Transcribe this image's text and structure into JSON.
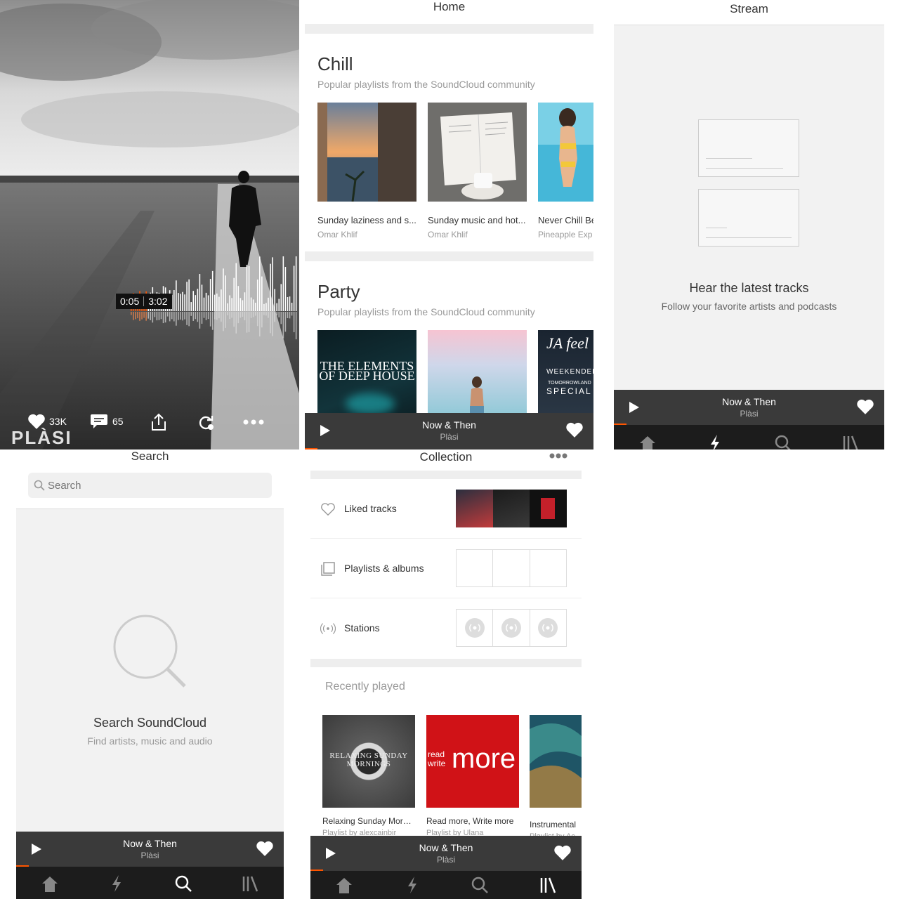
{
  "player_screen": {
    "time_current": "0:05",
    "time_total": "3:02",
    "likes": "33K",
    "comments": "65",
    "watermark": "PLÀSI",
    "icons": [
      "heart-icon",
      "comment-icon",
      "share-icon",
      "repost-icon",
      "more-icon"
    ]
  },
  "home": {
    "title": "Home",
    "sections": [
      {
        "title": "Chill",
        "subtitle": "Popular playlists from the SoundCloud community",
        "items": [
          {
            "title": "Sunday laziness and s...",
            "author": "Omar Khlif"
          },
          {
            "title": "Sunday music and hot...",
            "author": "Omar Khlif"
          },
          {
            "title": "Never Chill Be",
            "author": "Pineapple Exp"
          }
        ]
      },
      {
        "title": "Party",
        "subtitle": "Popular playlists from the SoundCloud community",
        "items": [
          {
            "title": "THE ELEMENTS OF DEEP HOUSE",
            "author": ""
          },
          {
            "title": "",
            "author": ""
          },
          {
            "title": "JA feel WEEKENDER TOMORROWLAND SPECIAL",
            "author": ""
          }
        ]
      }
    ]
  },
  "stream": {
    "title": "Stream",
    "empty_title": "Hear the latest tracks",
    "empty_subtitle": "Follow your favorite artists and podcasts"
  },
  "search": {
    "title": "Search",
    "placeholder": "Search",
    "empty_title": "Search SoundCloud",
    "empty_subtitle": "Find artists, music and audio"
  },
  "collection": {
    "title": "Collection",
    "rows": [
      {
        "label": "Liked tracks",
        "icon": "heart-outline-icon"
      },
      {
        "label": "Playlists & albums",
        "icon": "playlist-icon"
      },
      {
        "label": "Stations",
        "icon": "station-icon"
      }
    ],
    "recent_title": "Recently played",
    "recent": [
      {
        "title": "Relaxing Sunday Morni...",
        "subtitle": "Playlist by alexcainbir",
        "art_text": "RELAXING SUNDAY MORNINGS"
      },
      {
        "title": "Read more, Write more",
        "subtitle": "Playlist by Ulana",
        "art_text_small": "read write",
        "art_text_big": "more"
      },
      {
        "title": "Instrumental",
        "subtitle": "Playlist by Ac"
      }
    ]
  },
  "now_playing": {
    "title": "Now & Then",
    "artist": "Plàsi"
  },
  "colors": {
    "accent": "#ff5500",
    "player_bg": "#3a3a3a",
    "tabbar_bg": "#1c1c1c",
    "empty_bg": "#f2f2f2"
  }
}
